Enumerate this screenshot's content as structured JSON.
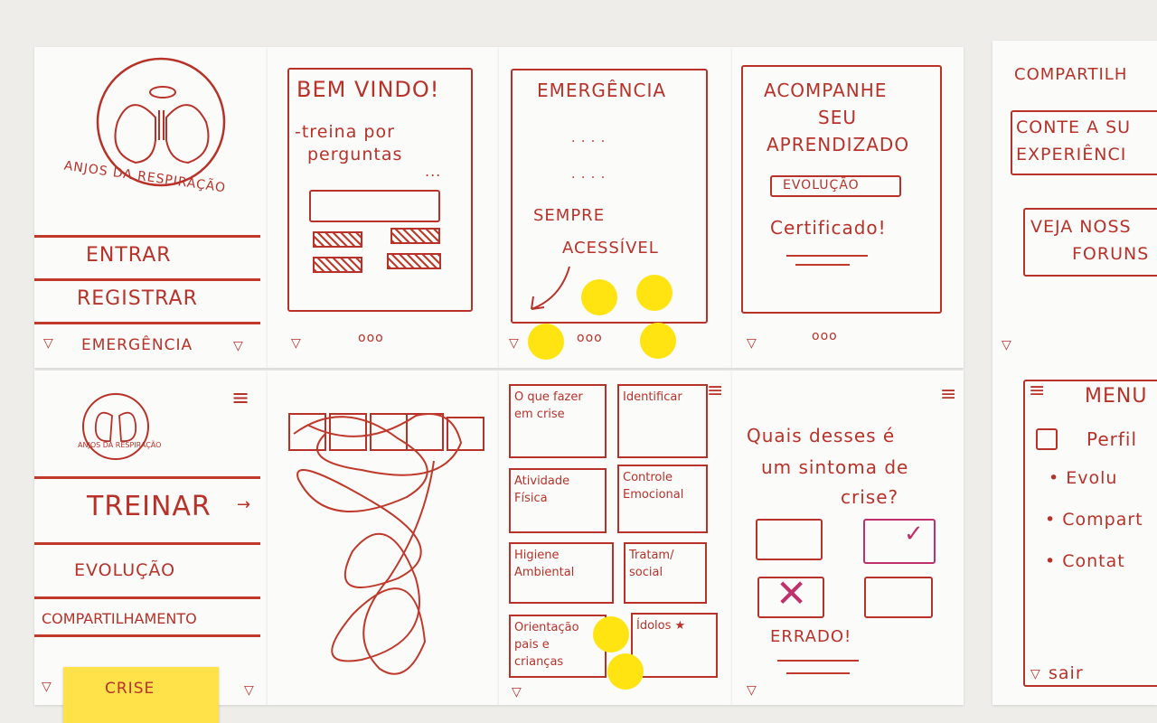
{
  "logo": {
    "arc_text": "ANJOS DA RESPIRAÇÃO",
    "small_text": "ANJOS DA RESPIRAÇÃO"
  },
  "login": {
    "enter": "ENTRAR",
    "register": "REGISTRAR",
    "emergency": "EMERGÊNCIA"
  },
  "welcome": {
    "title": "BEM VINDO!",
    "line1": "-treina por",
    "line2": "perguntas",
    "ellipsis": "...",
    "pager": "ooo"
  },
  "emergency": {
    "title": "EMERGÊNCIA",
    "dots1": ". . . .",
    "dots2": ". . . .",
    "line1": "SEMPRE",
    "line2": "ACESSÍVEL",
    "pager": "ooo"
  },
  "progress": {
    "line1": "ACOMPANHE",
    "line2": "SEU",
    "line3": "APRENDIZADO",
    "badge": "EVOLUÇÃO",
    "cert": "Certificado!",
    "pager": "ooo"
  },
  "share": {
    "title": "COMPARTILH",
    "box1_line1": "CONTE A SU",
    "box1_line2": "EXPERIÊNCI",
    "box2_line1": "VEJA NOSS",
    "box2_line2": "FORUNS"
  },
  "home_menu": {
    "train": "TREINAR",
    "evolution": "EVOLUÇÃO",
    "share": "COMPARTILHAMENTO"
  },
  "topics": [
    {
      "label": "O que fazer em crise"
    },
    {
      "label": "Identificar"
    },
    {
      "label": "Atividade Física"
    },
    {
      "label": "Controle Emocional"
    },
    {
      "label": "Higiene Ambiental"
    },
    {
      "label": "Tratam/ social"
    },
    {
      "label": "Orientação pais e crianças"
    },
    {
      "label": "Ídolos ★"
    }
  ],
  "quiz": {
    "q1": "Quais desses é",
    "q2": "um sintoma de",
    "q3": "crise?",
    "wrong": "ERRADO!"
  },
  "side_menu": {
    "title": "MENU",
    "profile": "Perfil",
    "evolution": "• Evolu",
    "share": "• Compart",
    "contact": "• Contat",
    "exit": "sair"
  },
  "sticky": {
    "label": "CRISE"
  },
  "colors": {
    "marker": "#b8322a",
    "dot": "#ffe412",
    "sticky": "#ffe14a"
  }
}
